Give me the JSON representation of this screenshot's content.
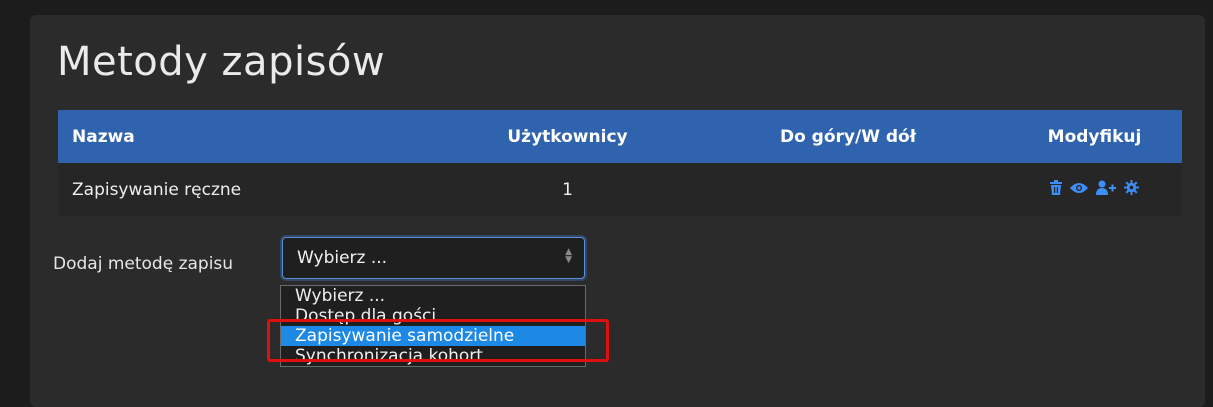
{
  "page": {
    "title": "Metody zapisów"
  },
  "table": {
    "headers": [
      "Nazwa",
      "Użytkownicy",
      "Do góry/W dół",
      "Modyfikuj"
    ],
    "rows": [
      {
        "name": "Zapisywanie ręczne",
        "users": "1",
        "updown": ""
      }
    ],
    "modify_icons": [
      "trash-icon",
      "eye-icon",
      "add-user-icon",
      "gear-icon"
    ]
  },
  "add_method": {
    "label": "Dodaj metodę zapisu",
    "selected": "Wybierz ...",
    "options": [
      "Wybierz ...",
      "Dostęp dla gości",
      "Zapisywanie samodzielne",
      "Synchronizacja kohort"
    ],
    "highlighted_option": "Zapisywanie samodzielne"
  },
  "colors": {
    "header_bg": "#2f63ad",
    "icon": "#3e8ef7",
    "selection": "#1e88e5",
    "highlight_box": "#e01010"
  }
}
